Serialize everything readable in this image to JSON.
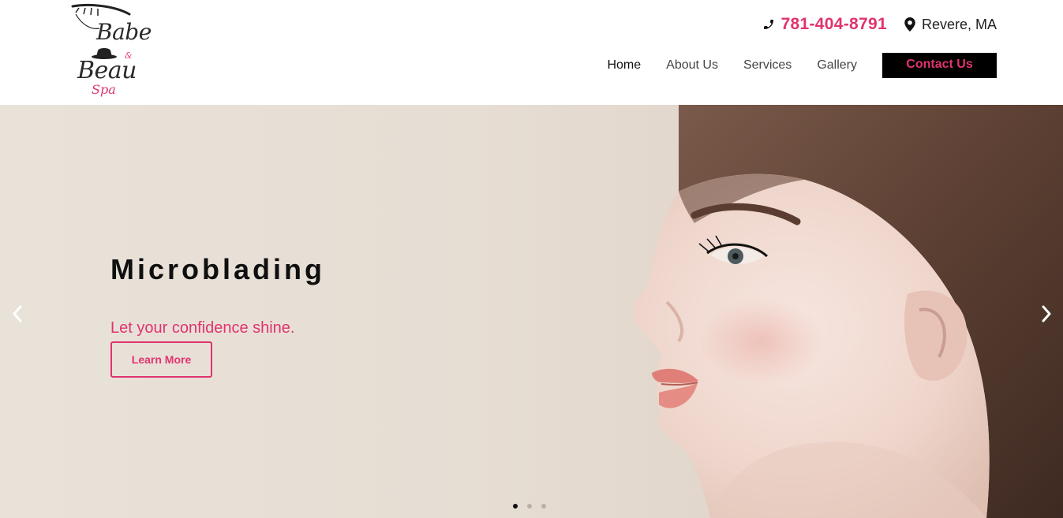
{
  "brand": {
    "logo_lines": [
      "Babe",
      "&",
      "Beau",
      "Spa"
    ],
    "logo_icon": "eyelash-icon",
    "hat_icon": "fedora-hat-icon",
    "accent_color": "#e0336f"
  },
  "header": {
    "phone": "781-404-8791",
    "phone_icon": "phone-icon",
    "location": "Revere, MA",
    "location_icon": "map-pin-icon"
  },
  "nav": {
    "items": [
      {
        "label": "Home",
        "active": true
      },
      {
        "label": "About Us",
        "active": false
      },
      {
        "label": "Services",
        "active": false
      },
      {
        "label": "Gallery",
        "active": false
      }
    ],
    "cta_label": "Contact Us"
  },
  "slider": {
    "title": "Microblading",
    "subtitle": "Let your confidence shine.",
    "button_label": "Learn More",
    "prev_icon": "chevron-left-icon",
    "next_icon": "chevron-right-icon",
    "slide_count": 3,
    "active_slide": 1
  }
}
